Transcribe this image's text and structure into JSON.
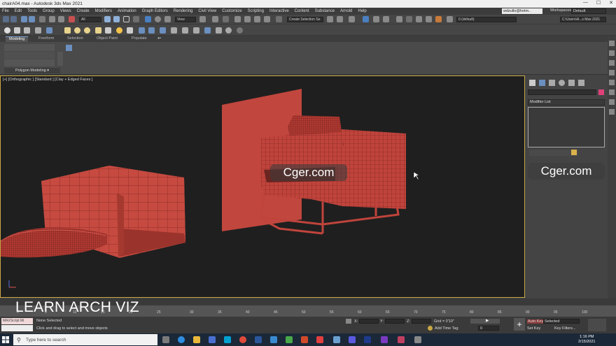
{
  "window": {
    "title": "chairA04.max - Autodesk 3ds Max 2021",
    "controls": [
      "—",
      "☐",
      "✕"
    ]
  },
  "menu": [
    "File",
    "Edit",
    "Tools",
    "Group",
    "Views",
    "Create",
    "Modifiers",
    "Animation",
    "Graph Editors",
    "Rendering",
    "Civil View",
    "Customize",
    "Scripting",
    "Interactive",
    "Content",
    "Substance",
    "Arnold",
    "Help"
  ],
  "user": {
    "name": "wdzullo@hotm..",
    "workspaces_label": "Workspaces:",
    "workspace": "Default"
  },
  "toolbar": {
    "filter": "All",
    "refcoord": "View",
    "selection_set": "Create Selection Se",
    "layer": "0 (default)",
    "path": "C:\\Users\\A...s Max 2021"
  },
  "ribbon": {
    "tabs": [
      "Modeling",
      "Freeform",
      "Selection",
      "Object Paint",
      "Populate"
    ],
    "group": "Polygon Modeling ▾"
  },
  "viewport": {
    "label": "[+] [Orthographic ] [Standard ] [Clay + Edged Faces ]"
  },
  "watermark": "Cger.com",
  "command_panel": {
    "modifier_list": "Modifier List"
  },
  "timeline": {
    "ticks": [
      "0",
      "5",
      "10",
      "15",
      "20",
      "25",
      "30",
      "35",
      "40",
      "45",
      "50",
      "55",
      "60",
      "65",
      "70",
      "75",
      "80",
      "85",
      "90",
      "95",
      "100"
    ],
    "overlay": "LEARN ARCH VIZ"
  },
  "status": {
    "maxscript": "MAXScript Mi",
    "selection": "None Selected",
    "prompt": "Click and drag to select and move objects",
    "x_label": "X:",
    "y_label": "Y:",
    "z_label": "Z:",
    "grid": "Grid = 0'10\"",
    "add_time_tag": "Add Time Tag",
    "auto_key": "Auto Key",
    "set_key": "Set Key",
    "selected": "Selected",
    "key_filters": "Key Filters...",
    "frame": "0"
  },
  "taskbar": {
    "search": "Type here to search",
    "time": "1:16 PM",
    "date": "2/15/2021"
  },
  "colors": {
    "accent_selection": "#c8a844",
    "model_red": "#c0443c",
    "taskbar": "#1b2838"
  }
}
